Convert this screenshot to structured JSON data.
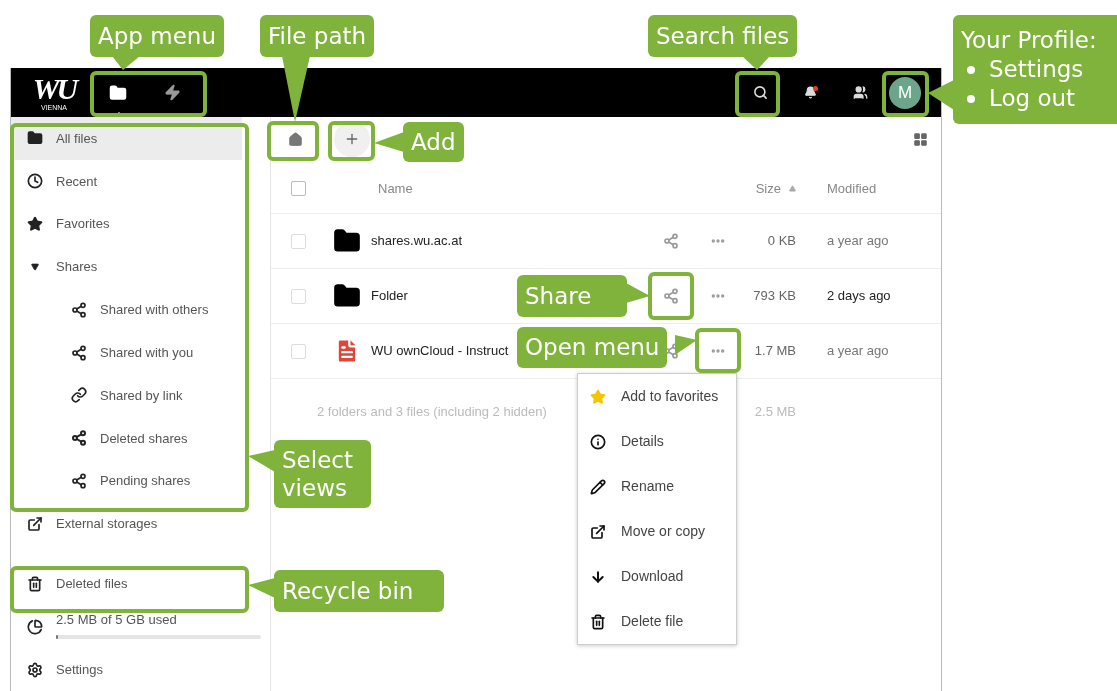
{
  "header": {
    "logo": "WU",
    "logo_sub": "VIENNA",
    "apps": [
      {
        "kind": "files",
        "selected": true
      },
      {
        "kind": "activity",
        "selected": false
      }
    ],
    "notifications_unread": true,
    "avatar": "M"
  },
  "toolbar": {
    "kind": "breadcrumb"
  },
  "sidebar": {
    "items": [
      {
        "kind": "folder",
        "label": "All files",
        "selected": true
      },
      {
        "kind": "clock",
        "label": "Recent",
        "selected": false
      },
      {
        "kind": "star",
        "label": "Favorites",
        "selected": false
      },
      {
        "kind": "caret",
        "label": "Shares",
        "selected": false,
        "expanded": true,
        "children": [
          {
            "kind": "share",
            "label": "Shared with others",
            "selected": false
          },
          {
            "kind": "share",
            "label": "Shared with you",
            "selected": false
          },
          {
            "kind": "link",
            "label": "Shared by link",
            "selected": false
          },
          {
            "kind": "share-deleted",
            "label": "Deleted shares",
            "selected": false
          },
          {
            "kind": "share",
            "label": "Pending shares",
            "selected": false
          }
        ]
      },
      {
        "kind": "external",
        "label": "External storages",
        "selected": false
      }
    ],
    "trash": {
      "label": "Deleted files"
    },
    "quota": {
      "label": "2.5 MB of 5 GB used",
      "level": 0.01
    },
    "settings": {
      "label": "Settings"
    }
  },
  "table": {
    "select_all_checked": false,
    "columns": [
      {
        "label": "Name",
        "sorted": false
      },
      {
        "label": "Size",
        "sorted": true
      },
      {
        "label": "Modified",
        "sorted": false
      }
    ],
    "rows": [
      {
        "kind": "folder",
        "name": "shares.wu.ac.at",
        "size": "0 KB",
        "modified": "a year ago",
        "recent": false,
        "checked": false
      },
      {
        "kind": "folder",
        "name": "Folder",
        "size": "793 KB",
        "modified": "2 days ago",
        "recent": true,
        "checked": false
      },
      {
        "kind": "pdf",
        "name": "WU ownCloud - Instruct",
        "size": "1.7 MB",
        "modified": "a year ago",
        "recent": false,
        "checked": false
      }
    ],
    "summary": {
      "text": "2 folders and 3 files (including 2 hidden)",
      "size": "2.5 MB"
    }
  },
  "menu": {
    "items": [
      {
        "kind": "star",
        "label": "Add to favorites"
      },
      {
        "kind": "info",
        "label": "Details"
      },
      {
        "kind": "rename",
        "label": "Rename"
      },
      {
        "kind": "move",
        "label": "Move or copy"
      },
      {
        "kind": "download",
        "label": "Download"
      },
      {
        "kind": "delete",
        "label": "Delete file"
      }
    ]
  },
  "callouts": [
    {
      "text": "App menu"
    },
    {
      "text": "File path"
    },
    {
      "text": "Search files"
    },
    {
      "text": "Your Profile:",
      "bullets": [
        "Settings",
        "Log out"
      ]
    },
    {
      "text": "Add"
    },
    {
      "text": "Share"
    },
    {
      "text": "Open menu"
    },
    {
      "text": "Select views"
    },
    {
      "text": "Recycle bin"
    }
  ]
}
